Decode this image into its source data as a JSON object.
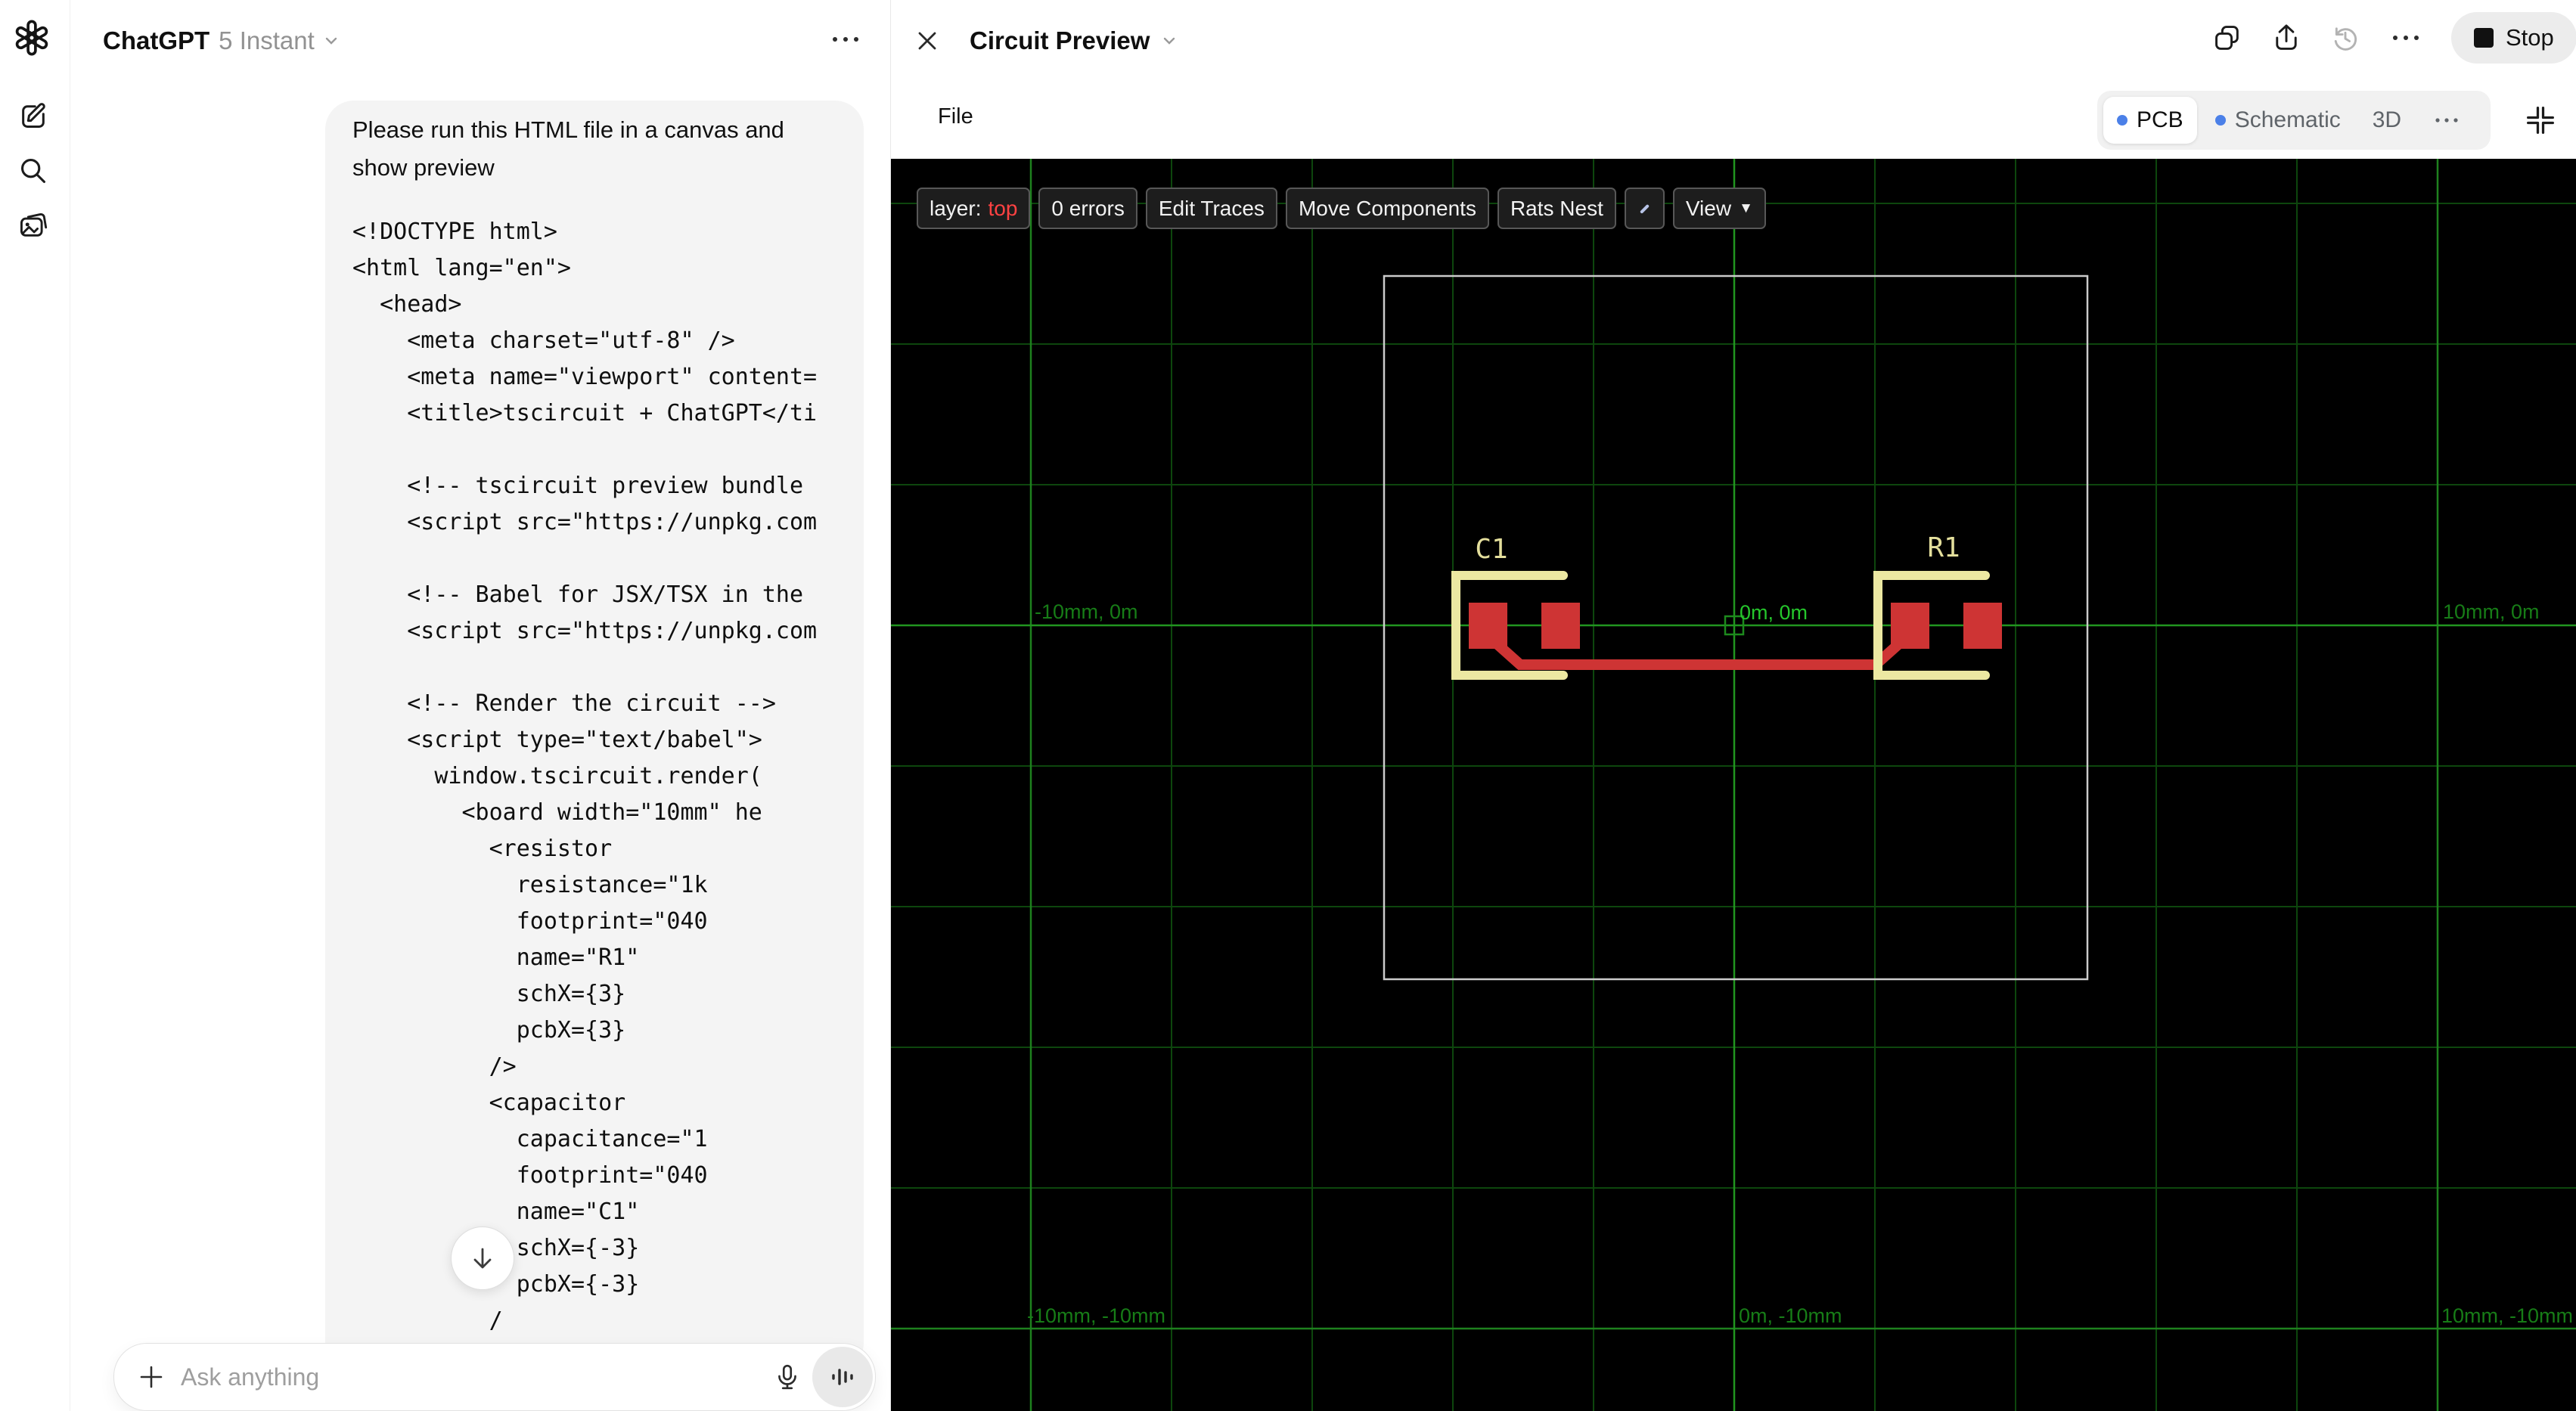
{
  "sidebar": {
    "icons": [
      "openai-logo",
      "new-chat",
      "search",
      "library"
    ]
  },
  "chat": {
    "header": {
      "title": "ChatGPT",
      "model": "5 Instant"
    },
    "message": {
      "line1": "Please run this HTML file in a canvas and",
      "line2": "show preview"
    },
    "code_lines": [
      "<!DOCTYPE html>",
      "<html lang=\"en\">",
      "  <head>",
      "    <meta charset=\"utf-8\" />",
      "    <meta name=\"viewport\" content=",
      "    <title>tscircuit + ChatGPT</ti",
      "",
      "    <!-- tscircuit preview bundle",
      "    <script src=\"https://unpkg.com",
      "",
      "    <!-- Babel for JSX/TSX in the",
      "    <script src=\"https://unpkg.com",
      "",
      "    <!-- Render the circuit -->",
      "    <script type=\"text/babel\">",
      "      window.tscircuit.render(",
      "        <board width=\"10mm\" he",
      "          <resistor",
      "            resistance=\"1k",
      "            footprint=\"040",
      "            name=\"R1\"",
      "            schX={3}",
      "            pcbX={3}",
      "          />",
      "          <capacitor",
      "            capacitance=\"1",
      "            footprint=\"040",
      "            name=\"C1\"",
      "            schX={-3}",
      "            pcbX={-3}",
      "          /"
    ],
    "composer": {
      "placeholder": "Ask anything"
    }
  },
  "canvas_panel": {
    "header": {
      "title": "Circuit Preview",
      "stop_label": "Stop"
    },
    "menu": {
      "file_label": "File"
    },
    "tabs": [
      {
        "label": "PCB",
        "active": true
      },
      {
        "label": "Schematic",
        "active": false
      },
      {
        "label": "3D",
        "active": false
      }
    ],
    "pcb": {
      "toolbar": {
        "layer_prefix": "layer:",
        "layer_value": "top",
        "errors": "0 errors",
        "edit_traces": "Edit Traces",
        "move_components": "Move Components",
        "rats_nest": "Rats Nest",
        "view": "View",
        "view_caret": "▼"
      },
      "components": [
        {
          "name": "C1"
        },
        {
          "name": "R1"
        }
      ],
      "coord_labels": {
        "left": "-10mm, 0m",
        "origin": "0m, 0m",
        "right": "10mm, 0m",
        "bottom_left": "-10mm, -10mm",
        "bottom_center": "0m, -10mm",
        "bottom_right": "10mm, -10mm"
      },
      "colors": {
        "background": "#000000",
        "grid_minor": "#0d460d",
        "grid_major": "#1e811e",
        "axis": "#21951f",
        "coord_label": "#177c17",
        "origin_label": "#25c62c",
        "board_outline": "#cbcbcb",
        "pad": "#ce3434",
        "trace": "#ce3434",
        "silkscreen": "#ece8a2",
        "layer_top_text": "#ff4242",
        "tab_dot": "#4b80e8"
      }
    }
  }
}
